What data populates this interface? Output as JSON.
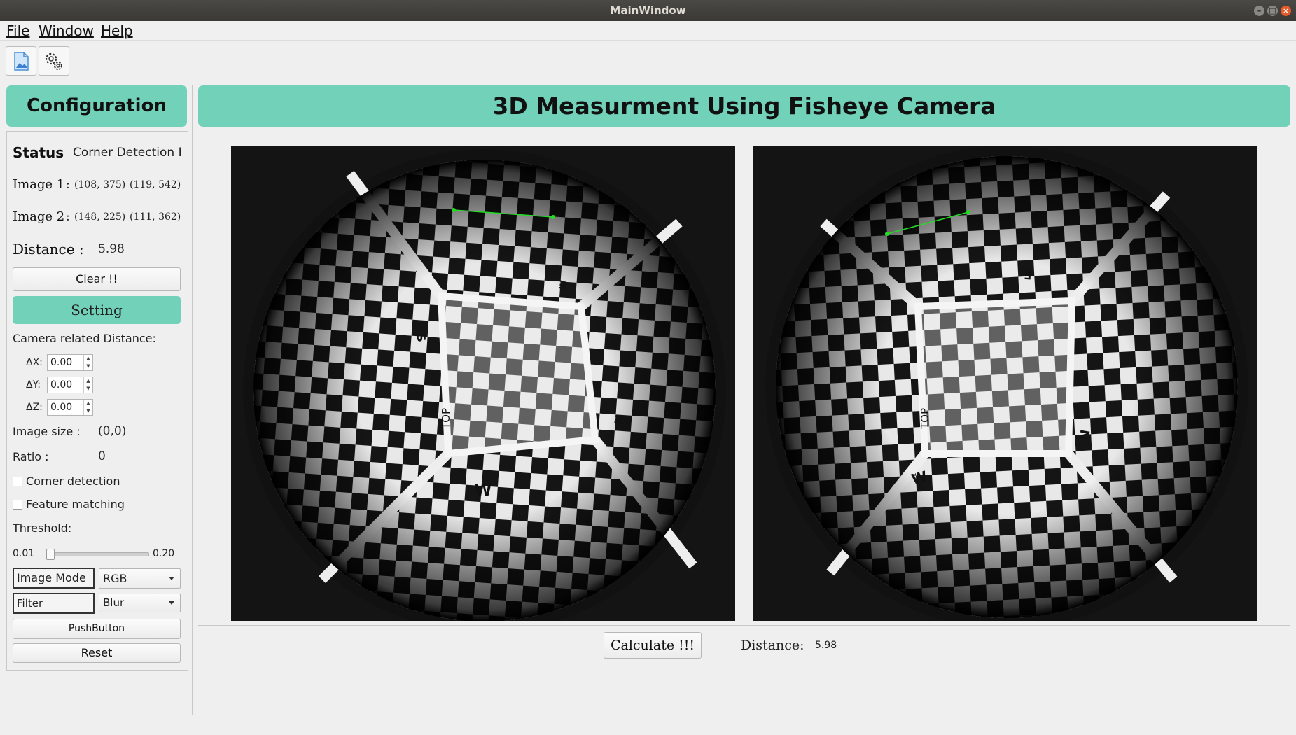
{
  "window": {
    "title": "MainWindow"
  },
  "menu": {
    "items": [
      "File",
      "Window",
      "Help"
    ]
  },
  "toolbar": {
    "icons": [
      "image-file-icon",
      "gears-icon"
    ]
  },
  "sidebar": {
    "header": "Configuration",
    "status_label": "Status",
    "status_value": "Corner Detection Pr",
    "image1_label": "Image 1",
    "image1_p1": "(108, 375)",
    "image1_p2": "(119, 542)",
    "image2_label": "Image 2",
    "image2_p1": "(148, 225)",
    "image2_p2": "(111, 362)",
    "distance_label": "Distance :",
    "distance_value": "5.98",
    "clear_label": "Clear !!",
    "setting_label": "Setting",
    "camera_distance_label": "Camera related Distance:",
    "dx_label": "ΔX:",
    "dx_value": "0.00",
    "dy_label": "ΔY:",
    "dy_value": "0.00",
    "dz_label": "ΔZ:",
    "dz_value": "0.00",
    "image_size_label": "Image size :",
    "image_size_value": "(0,0)",
    "ratio_label": "Ratio :",
    "ratio_value": "0",
    "corner_detection_label": "Corner detection",
    "feature_matching_label": "Feature matching",
    "threshold_label": "Threshold:",
    "threshold_min": "0.01",
    "threshold_max": "0.20",
    "threshold_level": 0,
    "image_mode_label": "Image Mode",
    "image_mode_value": "RGB",
    "filter_label": "Filter",
    "filter_value": "Blur",
    "pushbutton_label": "PushButton",
    "reset_label": "Reset"
  },
  "main": {
    "header": "3D Measurment Using Fisheye Camera",
    "left_image_marks": [
      "W",
      "TOP",
      "S",
      "E",
      "N"
    ],
    "right_image_marks": [
      "W",
      "TOP",
      "S",
      "E",
      "N"
    ],
    "calculate_label": "Calculate !!!",
    "distance_label": "Distance:",
    "distance_value": "5.98"
  },
  "colors": {
    "accent": "#72d1b9",
    "measure_line": "#22dd22"
  }
}
